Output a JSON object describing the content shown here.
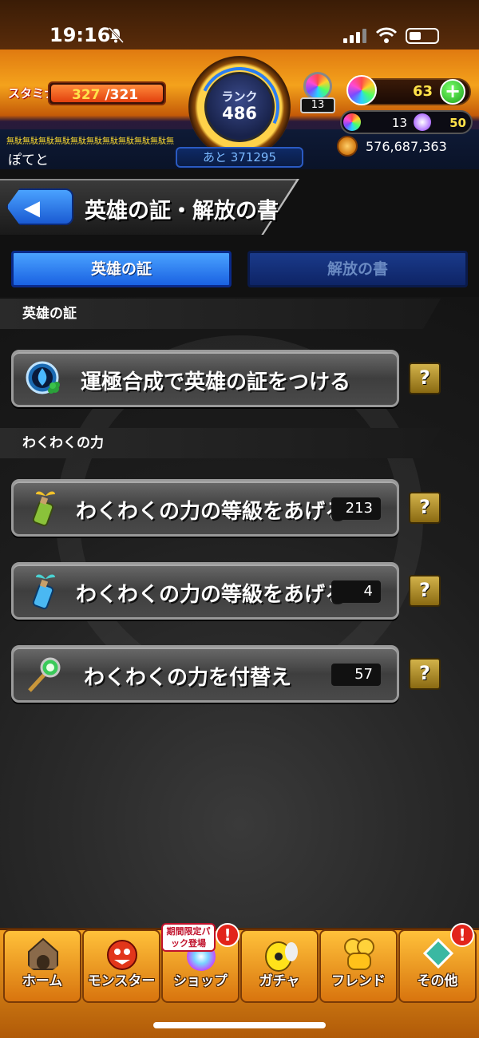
{
  "status_bar": {
    "time": "19:16"
  },
  "header": {
    "stamina_label": "スタミナ",
    "stamina_current": "327",
    "stamina_max": "/321",
    "marquee": "無駄無駄無駄無駄無駄無駄無駄無駄無駄無駄無駄無駄無駄無駄無駄",
    "username": "ぽてと",
    "rank_label": "ランク",
    "rank_value": "486",
    "rank_next": "あと 371295",
    "orb_small_count": "13",
    "gem_count": "63",
    "plus_label": "+",
    "mini_orb_count": "13",
    "star_orb_count": "50",
    "coins": "576,687,363"
  },
  "page": {
    "back_label": "◀",
    "title": "英雄の証・解放の書",
    "tabs": [
      {
        "label": "英雄の証",
        "active": true
      },
      {
        "label": "解放の書",
        "active": false
      }
    ],
    "sections": [
      {
        "title": "英雄の証"
      },
      {
        "title": "わくわくの力"
      }
    ],
    "menu": [
      {
        "label": "運極合成で英雄の証をつける",
        "icon": "hero-badge-icon",
        "count": null,
        "help": "?"
      },
      {
        "label": "わくわくの力の等級をあげる",
        "icon": "sprout-bottle-icon",
        "count": "213",
        "help": "?"
      },
      {
        "label": "わくわくの力の等級をあげる",
        "icon": "el-bottle-icon",
        "count": "4",
        "help": "?"
      },
      {
        "label": "わくわくの力を付替え",
        "icon": "orb-wand-icon",
        "count": "57",
        "help": "?"
      }
    ]
  },
  "bottom_nav": {
    "items": [
      {
        "label": "ホーム",
        "icon": "home-icon"
      },
      {
        "label": "モンスター",
        "icon": "monster-icon"
      },
      {
        "label": "ショップ",
        "icon": "shop-icon"
      },
      {
        "label": "ガチャ",
        "icon": "gacha-icon"
      },
      {
        "label": "フレンド",
        "icon": "friend-icon"
      },
      {
        "label": "その他",
        "icon": "other-icon"
      }
    ],
    "shop_tag": "期間限定パック登場",
    "badge": "!"
  },
  "colors": {
    "accent_orange": "#f2a020",
    "tab_blue": "#1a62e2",
    "help_gold": "#d2b24a"
  }
}
